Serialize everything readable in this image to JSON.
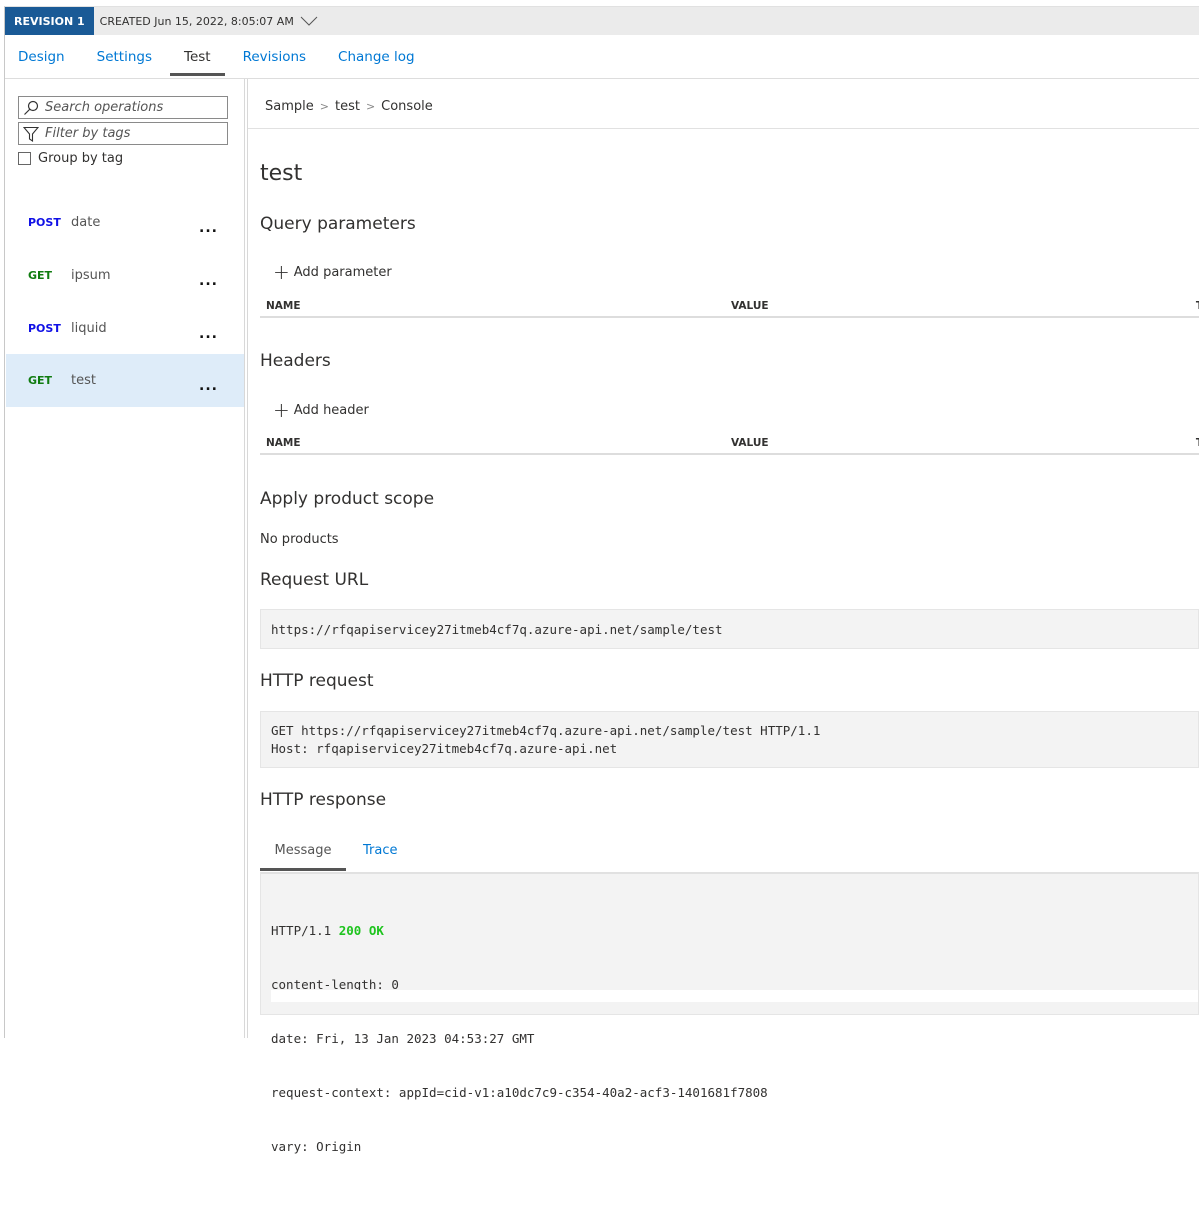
{
  "revision": {
    "badge": "REVISION 1",
    "created": "CREATED Jun 15, 2022, 8:05:07 AM"
  },
  "tabs": [
    {
      "label": "Design"
    },
    {
      "label": "Settings"
    },
    {
      "label": "Test",
      "active": true
    },
    {
      "label": "Revisions"
    },
    {
      "label": "Change log"
    }
  ],
  "sidebar": {
    "search_placeholder": "Search operations",
    "filter_placeholder": "Filter by tags",
    "group_by_tag": "Group by tag",
    "group_by_tag_checked": false,
    "operations": [
      {
        "verb": "POST",
        "name": "date"
      },
      {
        "verb": "GET",
        "name": "ipsum"
      },
      {
        "verb": "POST",
        "name": "liquid"
      },
      {
        "verb": "GET",
        "name": "test",
        "selected": true
      }
    ],
    "more_label": "..."
  },
  "breadcrumb": [
    "Sample",
    "test",
    "Console"
  ],
  "breadcrumb_sep": ">",
  "main": {
    "title": "test",
    "query": {
      "heading": "Query parameters",
      "add": "Add parameter",
      "columns": [
        "NAME",
        "VALUE",
        "T"
      ]
    },
    "headers": {
      "heading": "Headers",
      "add": "Add header",
      "columns": [
        "NAME",
        "VALUE",
        "T"
      ]
    },
    "product_scope": {
      "heading": "Apply product scope",
      "value": "No products"
    },
    "request_url": {
      "heading": "Request URL",
      "value": "https://rfqapiservicey27itmeb4cf7q.azure-api.net/sample/test"
    },
    "http_request": {
      "heading": "HTTP request",
      "lines": [
        "GET https://rfqapiservicey27itmeb4cf7q.azure-api.net/sample/test HTTP/1.1",
        "Host: rfqapiservicey27itmeb4cf7q.azure-api.net"
      ]
    },
    "http_response": {
      "heading": "HTTP response",
      "tabs": [
        "Message",
        "Trace"
      ],
      "active_tab": "Message",
      "status_prefix": "HTTP/1.1 ",
      "status": "200 OK",
      "lines": [
        "content-length: 0",
        "date: Fri, 13 Jan 2023 04:53:27 GMT",
        "request-context: appId=cid-v1:a10dc7c9-c354-40a2-acf3-1401681f7808",
        "vary: Origin"
      ]
    }
  },
  "colors": {
    "accent": "#0078d4",
    "badge": "#1a5a96",
    "post": "#1010e6",
    "get": "#107c10",
    "ok": "#1ec41e",
    "selected": "#deecf9"
  }
}
